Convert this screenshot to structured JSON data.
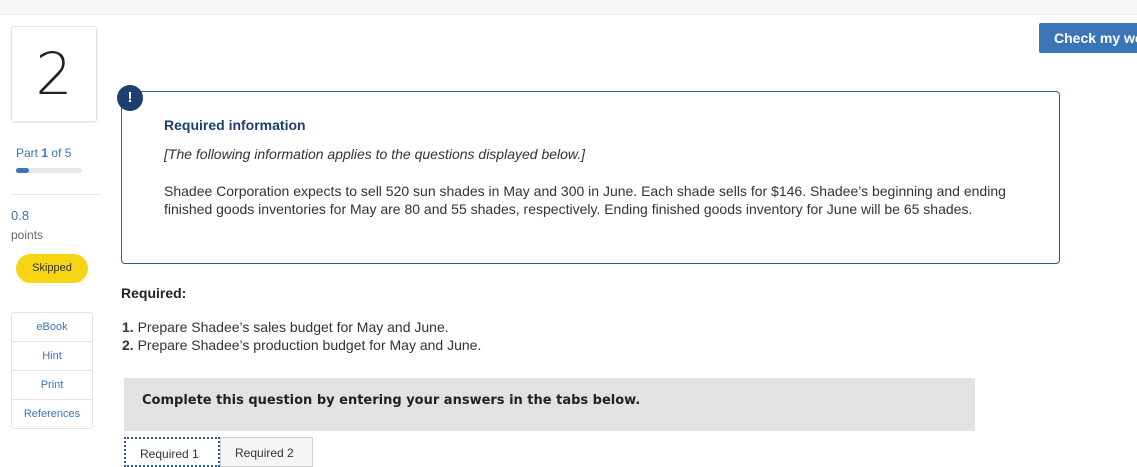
{
  "header": {
    "check_button": "Check my work"
  },
  "question": {
    "number": "2",
    "part_prefix": "Part",
    "part_current": "1",
    "part_suffix": "of 5",
    "part_progress": 0.2,
    "points_value": "0.8",
    "points_label": "points",
    "status_badge": "Skipped"
  },
  "tools": [
    "eBook",
    "Hint",
    "Print",
    "References"
  ],
  "info": {
    "title": "Required information",
    "intro": "[The following information applies to the questions displayed below.]",
    "body": "Shadee Corporation expects to sell 520 sun shades in May and 300 in June. Each shade sells for $146. Shadee’s beginning and ending finished goods inventories for May are 80 and 55 shades, respectively. Ending finished goods inventory for June will be 65 shades."
  },
  "required": {
    "label": "Required:",
    "items": [
      {
        "num": "1.",
        "text": "Prepare Shadee’s sales budget for May and June."
      },
      {
        "num": "2.",
        "text": "Prepare Shadee’s production budget for May and June."
      }
    ]
  },
  "complete_bar": "Complete this question by entering your answers in the tabs below.",
  "tabs": [
    "Required 1",
    "Required 2"
  ],
  "colors": {
    "accent": "#3a75b8",
    "navy": "#1d3f6d",
    "badge": "#f7d514"
  }
}
